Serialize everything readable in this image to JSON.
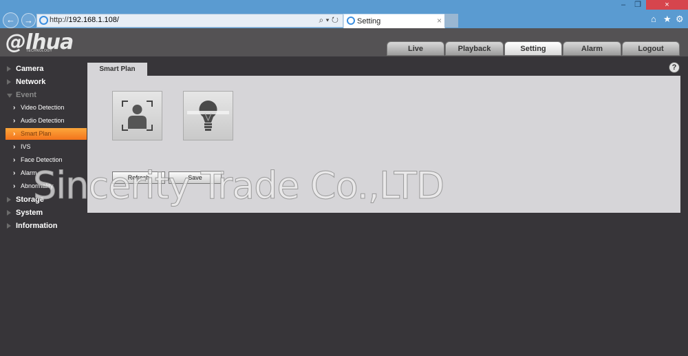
{
  "browser": {
    "address_prefix": "http://",
    "address_host": "192.168.1.108/",
    "tab_title": "Setting",
    "tab_close": "×",
    "window_controls": {
      "minimize": "–",
      "restore": "❐",
      "close": "×"
    },
    "toolbar_icons": [
      "home-icon",
      "star-icon",
      "gear-icon"
    ],
    "search_tools": "⌕ ▾ ↻"
  },
  "app": {
    "logo": "alhua",
    "logo_sub": "TECHNOLOGY",
    "nav": [
      {
        "label": "Live",
        "active": false
      },
      {
        "label": "Playback",
        "active": false
      },
      {
        "label": "Setting",
        "active": true
      },
      {
        "label": "Alarm",
        "active": false
      },
      {
        "label": "Logout",
        "active": false
      }
    ]
  },
  "sidebar": {
    "camera": "Camera",
    "network": "Network",
    "event": "Event",
    "event_items": [
      "Video Detection",
      "Audio Detection",
      "Smart Plan",
      "IVS",
      "Face Detection",
      "Alarm",
      "Abnormality"
    ],
    "active_item": "Smart Plan",
    "storage": "Storage",
    "system": "System",
    "information": "Information"
  },
  "content": {
    "tab": "Smart Plan",
    "help": "?",
    "plans": [
      "face-detection-plan",
      "ivs-plan"
    ],
    "refresh": "Refresh",
    "save": "Save"
  },
  "watermark": "Sincerity Trade Co.,LTD",
  "colors": {
    "accent": "#f58a2a",
    "browser_bar": "#5a9bd1",
    "close_red": "#d6454d",
    "panel": "#d6d5d8",
    "background": "#373539"
  }
}
